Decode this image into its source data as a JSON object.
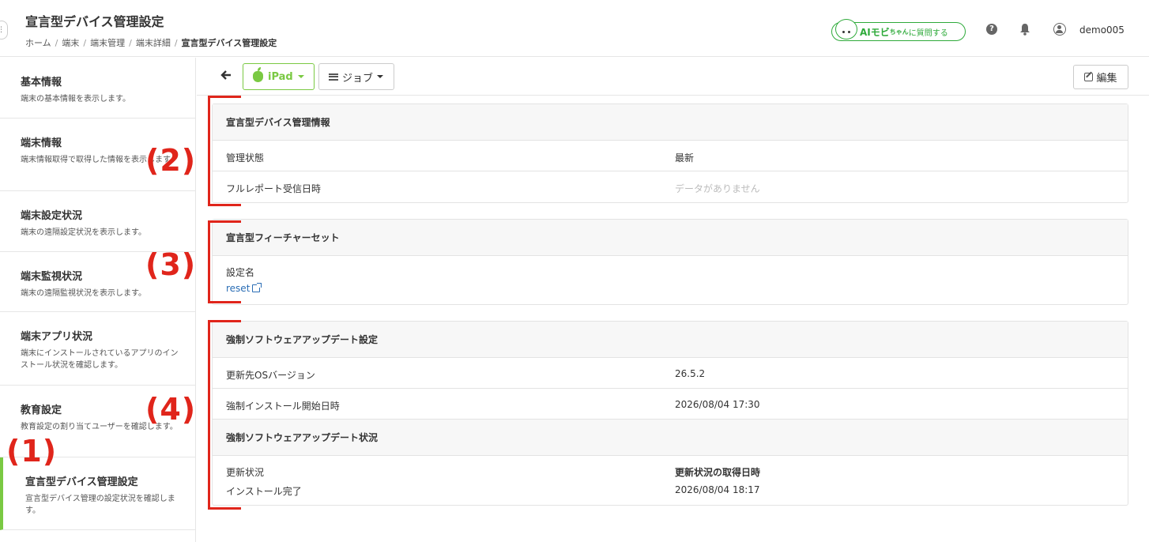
{
  "header": {
    "page_title": "宣言型デバイス管理設定",
    "breadcrumb": [
      "ホーム",
      "端末",
      "端末管理",
      "端末詳細",
      "宣言型デバイス管理設定"
    ],
    "ai_button": {
      "name": "AIモビ",
      "small": "ちゃん",
      "rest": "に質問する"
    },
    "icons": [
      "help-icon",
      "bell-icon",
      "user-icon"
    ],
    "username": "demo005"
  },
  "sidebar": {
    "items": [
      {
        "title": "基本情報",
        "desc": "端末の基本情報を表示します。"
      },
      {
        "title": "端末情報",
        "desc": "端末情報取得で取得した情報を表示します。"
      },
      {
        "title": "端末設定状況",
        "desc": "端末の遠隔設定状況を表示します。"
      },
      {
        "title": "端末監視状況",
        "desc": "端末の遠隔監視状況を表示します。"
      },
      {
        "title": "端末アプリ状況",
        "desc": "端末にインストールされているアプリのインストール状況を確認します。"
      },
      {
        "title": "教育設定",
        "desc": "教育設定の割り当てユーザーを確認します。"
      },
      {
        "title": "宣言型デバイス管理設定",
        "desc": "宣言型デバイス管理の設定状況を確認します。"
      }
    ],
    "active_index": 6,
    "active_color": "#7ac943"
  },
  "toolbar": {
    "device_label": "iPad",
    "job_label": "ジョブ",
    "edit_label": "編集",
    "accent_color": "#7ac943"
  },
  "panels": {
    "ddm_info": {
      "title": "宣言型デバイス管理情報",
      "rows": [
        {
          "key": "管理状態",
          "value": "最新"
        },
        {
          "key": "フルレポート受信日時",
          "value": "データがありません"
        }
      ]
    },
    "feature_set": {
      "title": "宣言型フィーチャーセット",
      "setting_label": "設定名",
      "setting_value": "reset"
    },
    "forced_update": {
      "title": "強制ソフトウェアアップデート設定",
      "rows": [
        {
          "key": "更新先OSバージョン",
          "value": "26.5.2"
        },
        {
          "key": "強制インストール開始日時",
          "value": "2026/08/04 17:30"
        }
      ],
      "status_title": "強制ソフトウェアアップデート状況",
      "status": {
        "col1_key": "更新状況",
        "col1_value": "インストール完了",
        "col2_key": "更新状況の取得日時",
        "col2_value": "2026/08/04 18:17"
      }
    }
  },
  "annotations": {
    "labels": [
      "(1)",
      "(2)",
      "(3)",
      "(4)"
    ],
    "color": "#e0251b"
  }
}
